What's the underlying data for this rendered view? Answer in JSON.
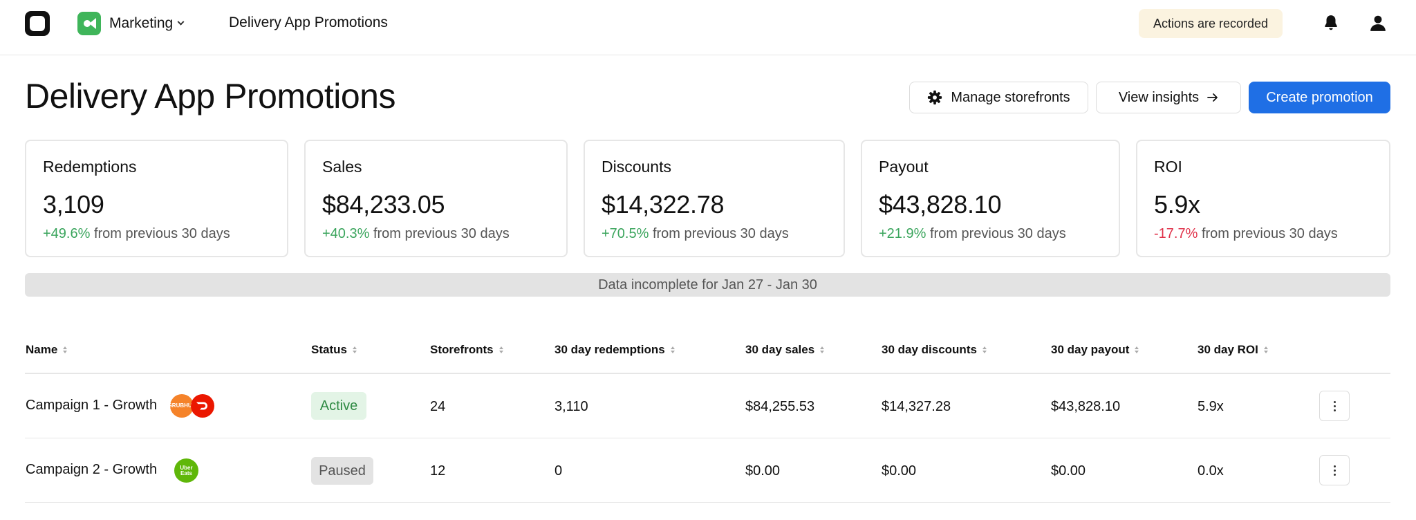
{
  "topbar": {
    "workspace": "Marketing",
    "breadcrumb": "Delivery App Promotions",
    "recorded_notice": "Actions are recorded",
    "icons": [
      "app-logo",
      "workspace-icon",
      "chevron-down-icon",
      "bell-icon",
      "user-icon"
    ]
  },
  "header": {
    "title": "Delivery App Promotions",
    "manage_label": "Manage storefronts",
    "insights_label": "View insights",
    "create_label": "Create promotion"
  },
  "stats": [
    {
      "label": "Redemptions",
      "value": "3,109",
      "delta": "+49.6%",
      "delta_suffix": "from previous 30 days",
      "trend": "positive"
    },
    {
      "label": "Sales",
      "value": "$84,233.05",
      "delta": "+40.3%",
      "delta_suffix": "from previous 30 days",
      "trend": "positive"
    },
    {
      "label": "Discounts",
      "value": "$14,322.78",
      "delta": "+70.5%",
      "delta_suffix": "from previous 30 days",
      "trend": "positive"
    },
    {
      "label": "Payout",
      "value": "$43,828.10",
      "delta": "+21.9%",
      "delta_suffix": "from previous 30 days",
      "trend": "positive"
    },
    {
      "label": "ROI",
      "value": "5.9x",
      "delta": "-17.7%",
      "delta_suffix": "from previous 30 days",
      "trend": "negative"
    }
  ],
  "banner": "Data incomplete for Jan 27 - Jan 30",
  "table": {
    "columns": [
      "Name",
      "Status",
      "Storefronts",
      "30 day redemptions",
      "30 day sales",
      "30 day discounts",
      "30 day payout",
      "30 day ROI"
    ],
    "rows": [
      {
        "name": "Campaign 1 - Growth",
        "status": "Active",
        "storefronts": "24",
        "redemptions": "3,110",
        "sales": "$84,255.53",
        "discounts": "$14,327.28",
        "payout": "$43,828.10",
        "roi": "5.9x",
        "apps": [
          "grubhub",
          "doordash"
        ]
      },
      {
        "name": "Campaign 2 - Growth",
        "status": "Paused",
        "storefronts": "12",
        "redemptions": "0",
        "sales": "$0.00",
        "discounts": "$0.00",
        "payout": "$0.00",
        "roi": "0.0x",
        "apps": [
          "ubereats"
        ]
      }
    ]
  },
  "app_logos": {
    "grubhub": {
      "text": "GRUBHUB",
      "color": "#f5832a"
    },
    "doordash": {
      "text": "",
      "color": "#eb1700"
    },
    "ubereats": {
      "text": "Uber Eats",
      "color": "#5fb709"
    }
  },
  "colors": {
    "primary": "#1f6fe5",
    "positive": "#3ba55d",
    "negative": "#e0324a",
    "workspace": "#3fb55a"
  }
}
